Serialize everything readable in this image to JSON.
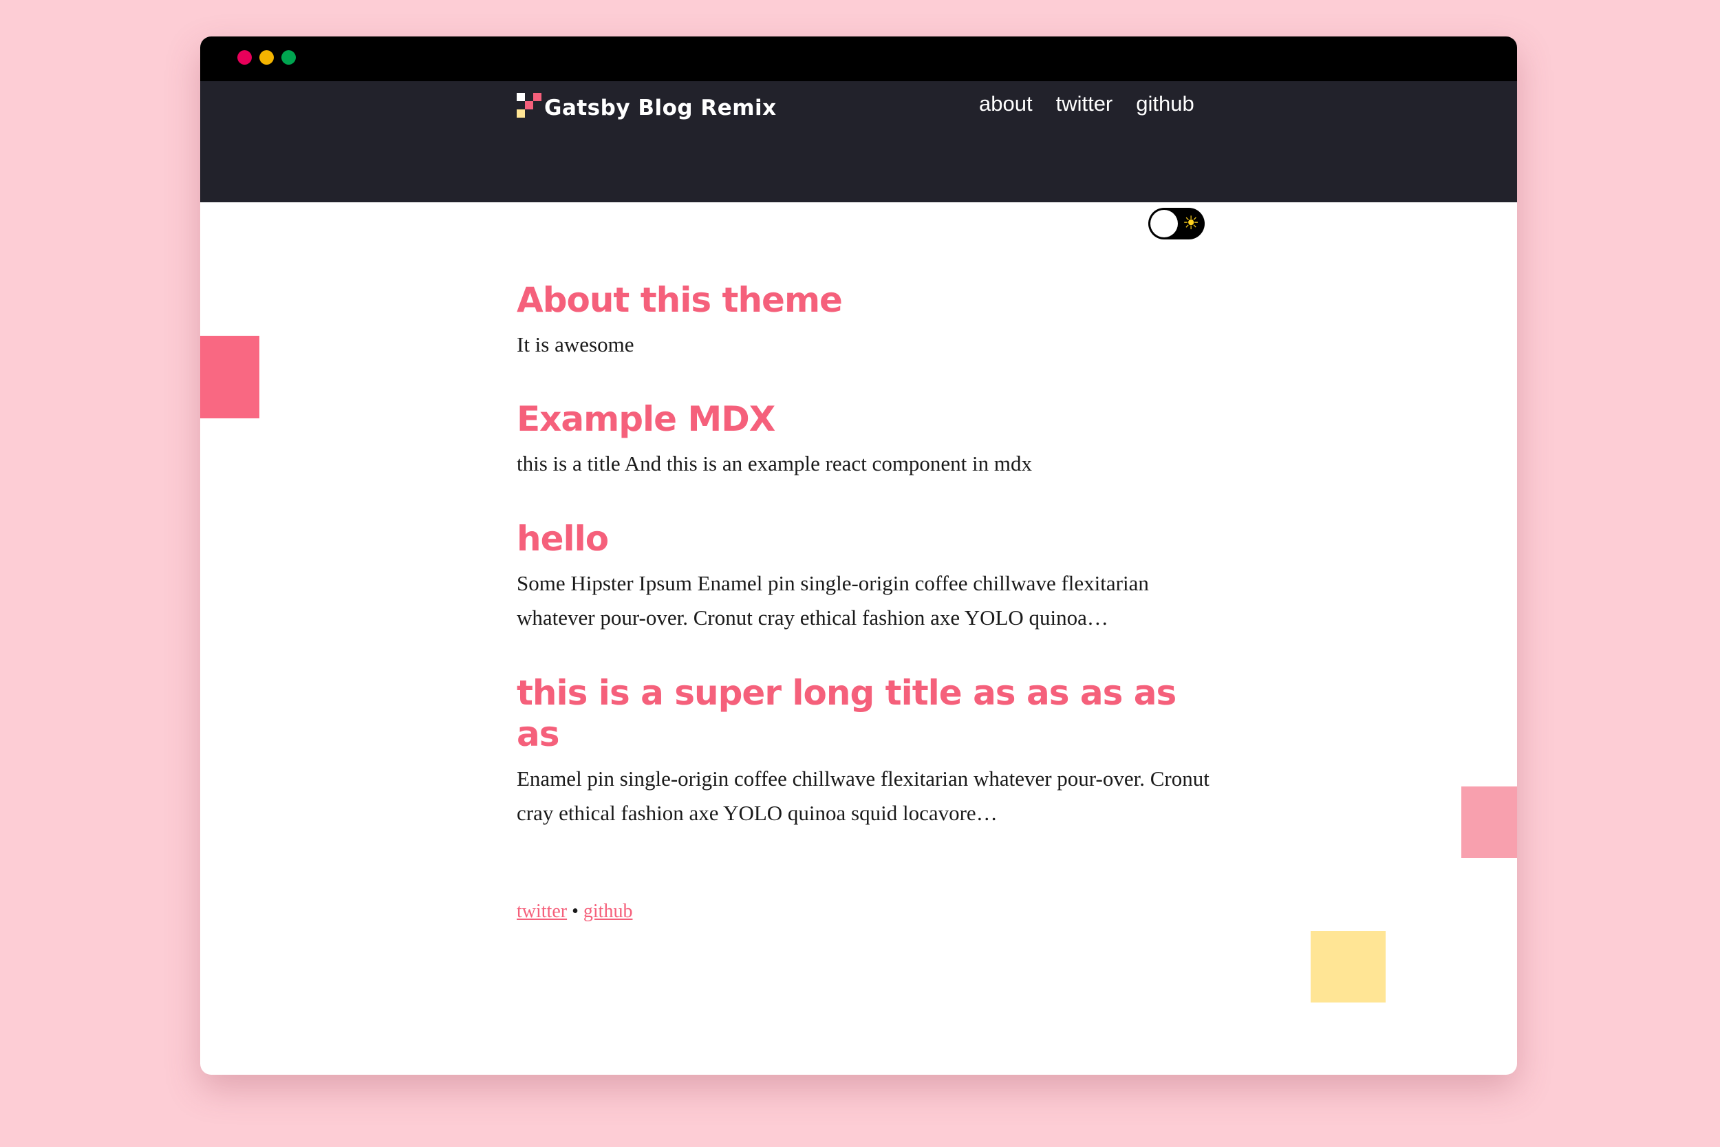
{
  "window": {
    "colors": {
      "close": "#e8005a",
      "minimize": "#f4b400",
      "maximize": "#00a550"
    }
  },
  "header": {
    "site_title": "Gatsby Blog Remix",
    "nav": [
      {
        "label": "about"
      },
      {
        "label": "twitter"
      },
      {
        "label": "github"
      }
    ]
  },
  "theme_toggle": {
    "state": "light",
    "icon": "sun-icon",
    "glyph": "☀"
  },
  "posts": [
    {
      "title": "About this theme",
      "excerpt": "It is awesome"
    },
    {
      "title": "Example MDX",
      "excerpt": "this is a title And this is an example react component in mdx"
    },
    {
      "title": "hello",
      "excerpt": "Some Hipster Ipsum Enamel pin single-origin coffee chillwave flexitarian whatever pour-over. Cronut cray ethical fashion axe YOLO quinoa…"
    },
    {
      "title": "this is a super long title as as as as as",
      "excerpt": "Enamel pin single-origin coffee chillwave flexitarian whatever pour-over. Cronut cray ethical fashion axe YOLO quinoa squid locavore…"
    }
  ],
  "footer": {
    "links": [
      {
        "label": "twitter"
      },
      {
        "label": "github"
      }
    ],
    "separator": "•"
  },
  "colors": {
    "accent": "#f5607b",
    "header_bg": "#22222b",
    "page_bg": "#fdcdd5",
    "highlight_yellow": "#ffe595"
  }
}
